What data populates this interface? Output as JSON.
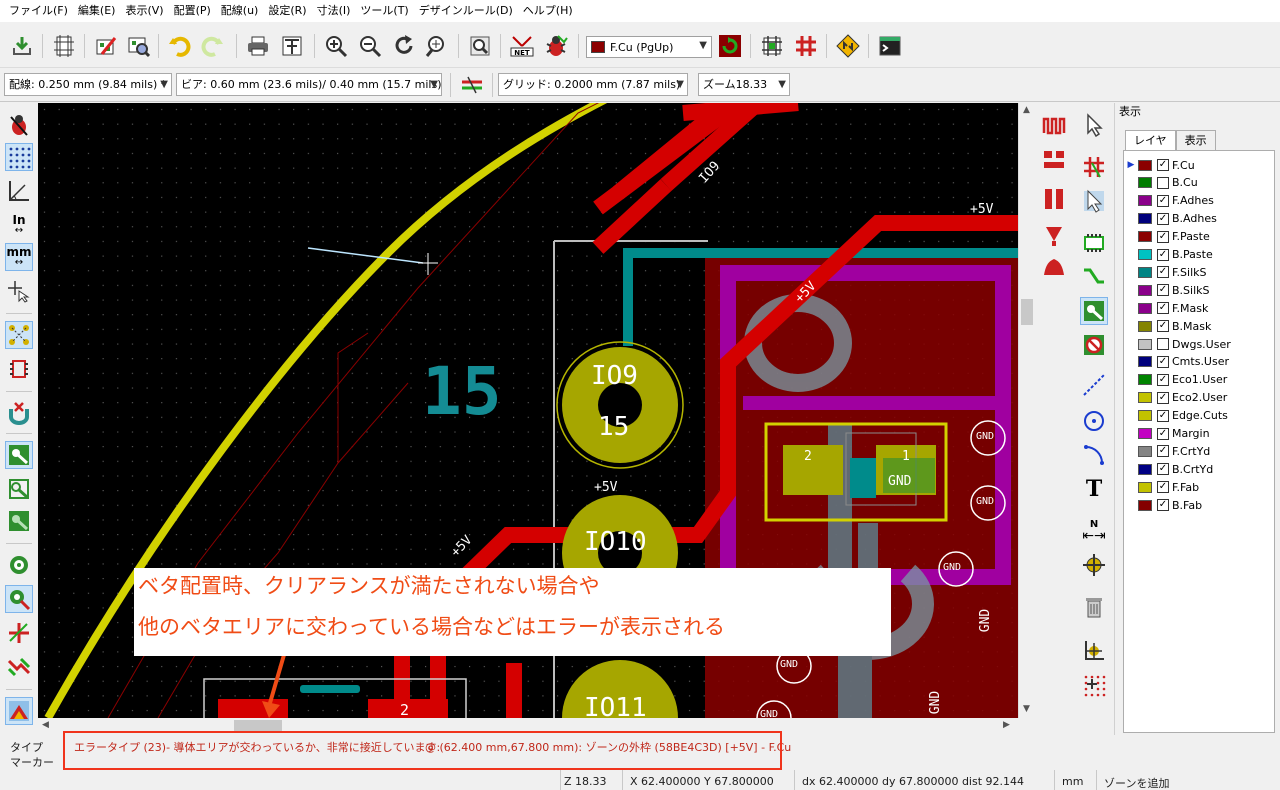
{
  "menu": [
    "ファイル(F)",
    "編集(E)",
    "表示(V)",
    "配置(P)",
    "配線(u)",
    "設定(R)",
    "寸法(I)",
    "ツール(T)",
    "デザインルール(D)",
    "ヘルプ(H)"
  ],
  "toolbar": {
    "layer_select": "F.Cu (PgUp)",
    "icons": [
      "save-icon",
      "page-settings-icon",
      "library-editor-icon",
      "library-browser-icon",
      "undo-icon",
      "redo-icon",
      "print-icon",
      "plot-icon",
      "zoom-in-icon",
      "zoom-out-icon",
      "redraw-icon",
      "zoom-fit-icon",
      "find-icon",
      "netlist-icon",
      "drc-icon",
      "layer-pair-icon",
      "autoplace-icon",
      "autoroute-icon",
      "microwave-icon",
      "scripting-console-icon"
    ]
  },
  "toolbar2": {
    "track": "配線: 0.250 mm (9.84 mils) *",
    "via": "ビア: 0.60 mm (23.6 mils)/ 0.40 mm (15.7 mils) *",
    "grid": "グリッド: 0.2000 mm (7.87 mils)",
    "zoom": "ズーム18.33"
  },
  "left_toolbar": {
    "inch_label": "In",
    "mm_label": "mm"
  },
  "canvas": {
    "labels": {
      "net_io9": "IO9",
      "net_5v_a": "+5V",
      "net_5v_b": "+5V",
      "net_5v_c": "+5V",
      "net_5v_d": "+5V",
      "silk_15": "15",
      "pad_io9": "IO9",
      "pad_15": "15",
      "pad_io10": "IO10",
      "pad_io11": "IO11",
      "pad_num_2": "2",
      "pad_num_1": "1",
      "pad_gnd_inner": "GND",
      "gnd_1": "GND",
      "gnd_2": "GND",
      "gnd_3": "GND",
      "gnd_4": "GND",
      "gnd_5": "GND",
      "gnd_v1": "GND",
      "gnd_v2": "GND",
      "pad_bottom_2": "2"
    }
  },
  "annotation": {
    "line1": "ベタ配置時、クリアランスが満たされない場合や",
    "line2": "他のベタエリアに交わっている場合などはエラーが表示される",
    "color": "#f04c16"
  },
  "right_toolbar": {
    "text_tool": "T",
    "dim_label": "N"
  },
  "panel": {
    "title": "表示",
    "tabs": [
      "レイヤ",
      "表示"
    ],
    "layers": [
      {
        "name": "F.Cu",
        "color": "#8b0000",
        "checked": true,
        "active": true
      },
      {
        "name": "B.Cu",
        "color": "#007c00",
        "checked": false,
        "active": false
      },
      {
        "name": "F.Adhes",
        "color": "#8b008b",
        "checked": true,
        "active": false
      },
      {
        "name": "B.Adhes",
        "color": "#00007c",
        "checked": true,
        "active": false
      },
      {
        "name": "F.Paste",
        "color": "#8b0000",
        "checked": true,
        "active": false
      },
      {
        "name": "B.Paste",
        "color": "#00c2c2",
        "checked": true,
        "active": false
      },
      {
        "name": "F.SilkS",
        "color": "#008484",
        "checked": true,
        "active": false
      },
      {
        "name": "B.SilkS",
        "color": "#8b008b",
        "checked": true,
        "active": false
      },
      {
        "name": "F.Mask",
        "color": "#8b008b",
        "checked": true,
        "active": false
      },
      {
        "name": "B.Mask",
        "color": "#848400",
        "checked": true,
        "active": false
      },
      {
        "name": "Dwgs.User",
        "color": "#c2c2c2",
        "checked": false,
        "active": false
      },
      {
        "name": "Cmts.User",
        "color": "#00007c",
        "checked": true,
        "active": false
      },
      {
        "name": "Eco1.User",
        "color": "#008400",
        "checked": true,
        "active": false
      },
      {
        "name": "Eco2.User",
        "color": "#c2c200",
        "checked": true,
        "active": false
      },
      {
        "name": "Edge.Cuts",
        "color": "#c2c200",
        "checked": true,
        "active": false
      },
      {
        "name": "Margin",
        "color": "#c200c2",
        "checked": true,
        "active": false
      },
      {
        "name": "F.CrtYd",
        "color": "#848484",
        "checked": true,
        "active": false
      },
      {
        "name": "B.CrtYd",
        "color": "#000084",
        "checked": true,
        "active": false
      },
      {
        "name": "F.Fab",
        "color": "#c2c200",
        "checked": true,
        "active": false
      },
      {
        "name": "B.Fab",
        "color": "#840000",
        "checked": true,
        "active": false
      }
    ]
  },
  "status": {
    "label_type": "タイプ",
    "label_marker": "マーカー",
    "error_text": "エラータイプ (23)- 導体エリアが交わっているか、非常に接近しています:",
    "error_loc": "@ (62.400 mm,67.800 mm): ゾーンの外枠  (58BE4C3D) [+5V] - F.Cu",
    "zoom": "Z 18.33",
    "xy": "X 62.400000  Y 67.800000",
    "dxy": "dx 62.400000  dy 67.800000  dist 92.144",
    "units": "mm",
    "mode": "ゾーンを追加"
  }
}
